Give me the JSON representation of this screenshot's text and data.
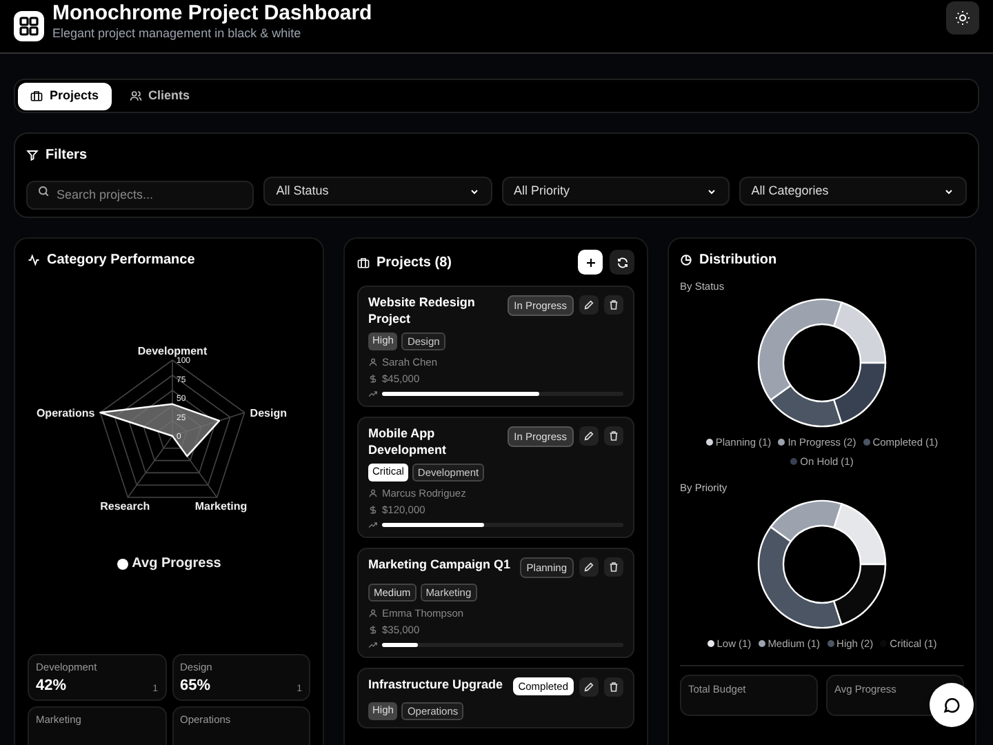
{
  "header": {
    "title": "Monochrome Project Dashboard",
    "subtitle": "Elegant project management in black & white"
  },
  "tabs": [
    {
      "label": "Projects",
      "selected": true,
      "kind": "projects"
    },
    {
      "label": "Clients",
      "selected": false,
      "kind": "clients"
    }
  ],
  "filters": {
    "title": "Filters",
    "search": {
      "placeholder": "Search projects..."
    },
    "selects": [
      "All Status",
      "All Priority",
      "All Categories"
    ]
  },
  "category_performance": {
    "title": "Category Performance",
    "chart_data": {
      "type": "radar",
      "categories": [
        "Development",
        "Design",
        "Marketing",
        "Research",
        "Operations"
      ],
      "series": [
        {
          "name": "Avg Progress",
          "color": "#ffffff",
          "values": [
            42,
            65,
            33,
            0,
            100
          ]
        }
      ],
      "ylim": [
        0,
        100
      ],
      "yticks": [
        0,
        25,
        50,
        75,
        100
      ]
    },
    "stats": [
      {
        "label": "Development",
        "value": "42%",
        "count": "1"
      },
      {
        "label": "Design",
        "value": "65%",
        "count": "1"
      },
      {
        "label": "Marketing"
      },
      {
        "label": "Operations"
      }
    ]
  },
  "projects": {
    "title": "Projects (8)",
    "items": [
      {
        "name": "Website Redesign Project",
        "status": {
          "text": "In Progress",
          "kind": "active"
        },
        "priority": {
          "text": "High",
          "kind": "high"
        },
        "category": "Design",
        "owner": "Sarah Chen",
        "budget": "$45,000",
        "level": 0.65
      },
      {
        "name": "Mobile App Development",
        "status": {
          "text": "In Progress",
          "kind": "active"
        },
        "priority": {
          "text": "Critical",
          "kind": "critical"
        },
        "category": "Development",
        "owner": "Marcus Rodriguez",
        "budget": "$120,000",
        "level": 0.42
      },
      {
        "name": "Marketing Campaign Q1",
        "status": {
          "text": "Planning",
          "kind": "planning"
        },
        "priority": {
          "text": "Medium",
          "kind": "medium"
        },
        "category": "Marketing",
        "owner": "Emma Thompson",
        "budget": "$35,000",
        "level": 0.15
      },
      {
        "name": "Infrastructure Upgrade",
        "status": {
          "text": "Completed",
          "kind": "completed"
        },
        "priority": {
          "text": "High",
          "kind": "high"
        },
        "category": "Operations"
      }
    ]
  },
  "distribution": {
    "title": "Distribution",
    "charts": [
      {
        "subtitle": "By Status",
        "chart_data": {
          "type": "donut",
          "categories": [
            "Planning",
            "In Progress",
            "Completed",
            "On Hold"
          ],
          "values": [
            20,
            40,
            20,
            20
          ],
          "colors": [
            "#d1d5db",
            "#9ca3af",
            "#4b5563",
            "#374151"
          ]
        },
        "legend_counts": [
          "(1)",
          "(2)",
          "(1)",
          "(1)"
        ]
      },
      {
        "subtitle": "By Priority",
        "chart_data": {
          "type": "donut",
          "categories": [
            "Low",
            "Medium",
            "High",
            "Critical"
          ],
          "values": [
            20,
            20,
            40,
            20
          ],
          "colors": [
            "#e5e7eb",
            "#9ca3af",
            "#4b5563",
            "#0a0a0a"
          ]
        },
        "legend_counts": [
          "(1)",
          "(1)",
          "(2)",
          "(1)"
        ]
      }
    ],
    "stats": [
      {
        "label": "Total Budget"
      },
      {
        "label": "Avg Progress"
      }
    ]
  }
}
